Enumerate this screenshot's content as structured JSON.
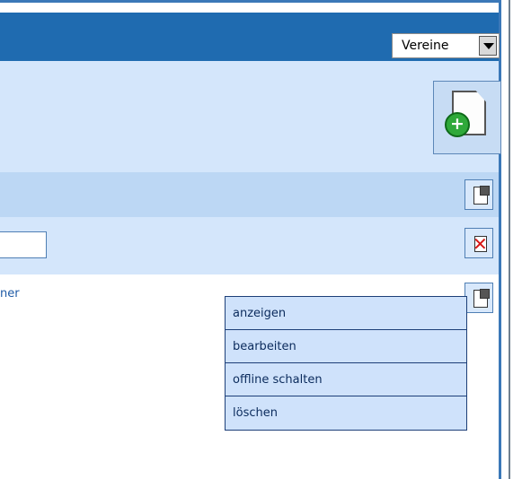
{
  "header": {
    "select_value": "Vereine"
  },
  "toolbar": {
    "icons": [
      "add-document-icon",
      "properties-icon",
      "delete-icon"
    ]
  },
  "list": {
    "fragment_text": "ner"
  },
  "context_menu": {
    "items": [
      {
        "label": "anzeigen"
      },
      {
        "label": "bearbeiten"
      },
      {
        "label": "offline schalten"
      },
      {
        "label": "löschen"
      }
    ]
  },
  "colors": {
    "header_blue": "#1f6bb0",
    "panel_light": "#d4e6fb",
    "panel_mid": "#bcd7f4",
    "menu_bg": "#cfe2fb",
    "menu_border": "#1d3f78",
    "text_link": "#1f5ba6"
  }
}
